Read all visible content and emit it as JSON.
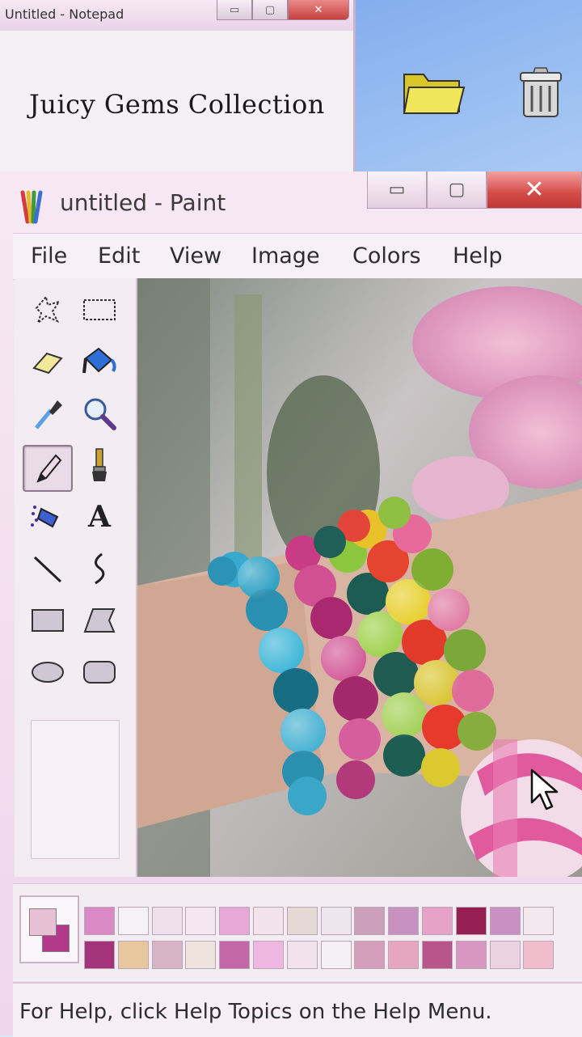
{
  "notepad": {
    "title": "Untitled - Notepad",
    "content": "Juicy Gems Collection",
    "controls": {
      "minimize": "▭",
      "maximize": "▢",
      "close": "✕"
    }
  },
  "desktop": {
    "icons": [
      "folder-icon",
      "recycle-bin-icon"
    ]
  },
  "paint": {
    "title": "untitled - Paint",
    "controls": {
      "minimize": "▭",
      "maximize": "▢",
      "close": "✕"
    },
    "menu": [
      "File",
      "Edit",
      "View",
      "Image",
      "Colors",
      "Help"
    ],
    "tools": [
      "free-form-select-icon",
      "rect-select-icon",
      "eraser-icon",
      "fill-bucket-icon",
      "color-picker-icon",
      "magnifier-icon",
      "pencil-icon",
      "brush-icon",
      "airbrush-icon",
      "text-tool-icon",
      "line-icon",
      "curve-icon",
      "rectangle-icon",
      "polygon-icon",
      "ellipse-icon",
      "rounded-rect-icon"
    ],
    "text_tool_glyph": "A",
    "selected_tool": "pencil-icon",
    "palette": {
      "top_row": [
        "#d98ac6",
        "#f6f1f5",
        "#efe1ec",
        "#f5e7f1",
        "#e7a8d7",
        "#f2e2e9",
        "#e4d9d4",
        "#eee6ec",
        "#caa0bb",
        "#c791c0",
        "#e6a3c7",
        "#951f52",
        "#c991c3",
        "#f3e8ee"
      ],
      "bottom_row": [
        "#a3337a",
        "#e9c79e",
        "#d6b4c6",
        "#efe3dd",
        "#c467a9",
        "#eeb6e1",
        "#f1e2ec",
        "#f5f0f3",
        "#d49fbb",
        "#e6a6bd",
        "#b8558a",
        "#d897c0",
        "#ecd2e0",
        "#f1bccc"
      ],
      "primary": "#e8c0d6",
      "secondary": "#b3398a"
    },
    "status": "For Help, click Help Topics on the Help Menu."
  }
}
